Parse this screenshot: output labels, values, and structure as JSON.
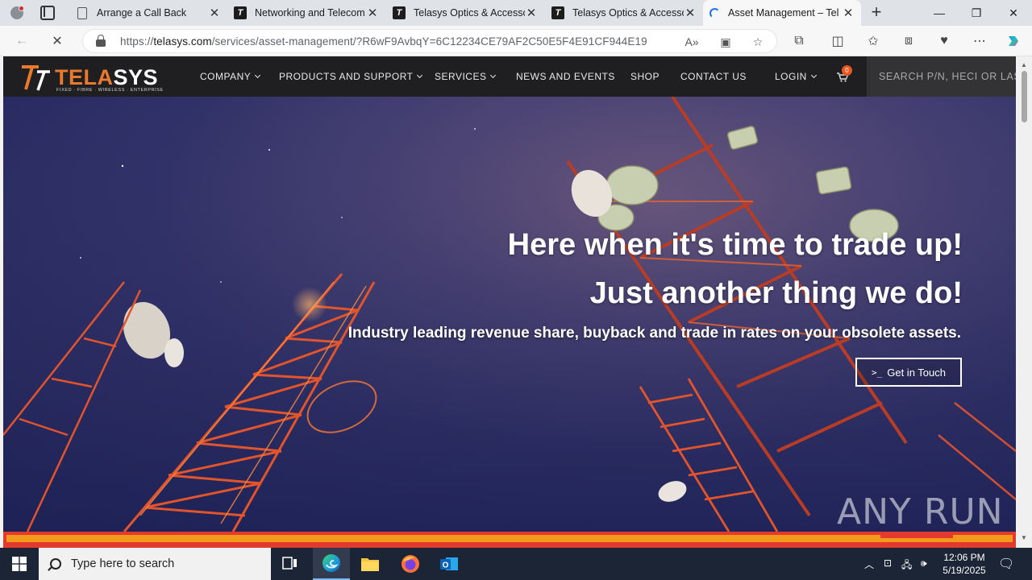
{
  "browser": {
    "tabs": [
      {
        "title": "Arrange a Call Back",
        "favicon": "document-icon"
      },
      {
        "title": "Networking and Telecom",
        "favicon": "telasys-icon"
      },
      {
        "title": "Telasys Optics & Accesso",
        "favicon": "telasys-icon"
      },
      {
        "title": "Telasys Optics & Accesso",
        "favicon": "telasys-icon"
      },
      {
        "title": "Asset Management – Tel",
        "favicon": "loading-icon"
      }
    ],
    "url_prefix": "https://",
    "url_domain": "telasys.com",
    "url_path": "/services/asset-management/?R6wF9AvbqY=6C12234CE79AF2C50E5F4E91CF944E19"
  },
  "site": {
    "logo": {
      "text_main": "TELA",
      "text_accent": "SYS",
      "tagline": "FIXED · FIBRE · WIRELESS · ENTERPRISE"
    },
    "menu": [
      {
        "label": "COMPANY",
        "has_dropdown": true
      },
      {
        "label": "PRODUCTS AND SUPPORT",
        "has_dropdown": true
      },
      {
        "label": "SERVICES",
        "has_dropdown": true
      },
      {
        "label": "NEWS AND EVENTS",
        "has_dropdown": false
      },
      {
        "label": "SHOP",
        "has_dropdown": false
      },
      {
        "label": "CONTACT US",
        "has_dropdown": false
      },
      {
        "label": "LOGIN",
        "has_dropdown": true
      }
    ],
    "cart_count": "0",
    "search_placeholder": "SEARCH P/N, HECI OR LAS",
    "hero": {
      "headline_1": "Here when it's time to trade up!",
      "headline_2": "Just another thing we do!",
      "subheading": "Industry leading revenue share, buyback and trade in rates on your obsolete assets.",
      "cta_prompt": ">_",
      "cta_label": "Get in Touch"
    },
    "watermark": "ANY RUN"
  },
  "taskbar": {
    "search_placeholder": "Type here to search",
    "time": "12:06 PM",
    "date": "5/19/2025"
  },
  "colors": {
    "accent_orange": "#e97a2d",
    "nav_bg": "#1f1f22",
    "stripe_red": "#e23a2f",
    "stripe_orange": "#f39a1c"
  }
}
